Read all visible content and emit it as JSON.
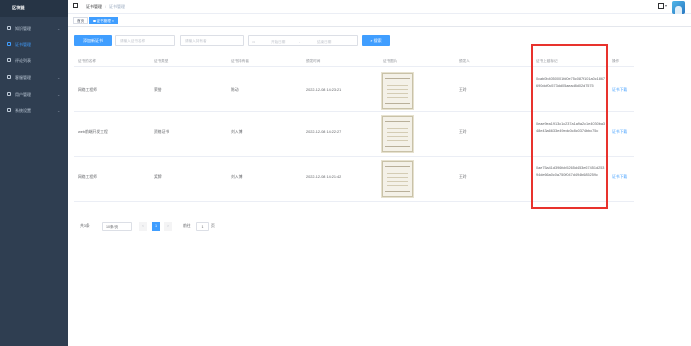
{
  "sidebar": {
    "title": "区块链",
    "items": [
      {
        "label": "知识管理",
        "icon": "doc-icon",
        "chevron": "⌄",
        "active": false
      },
      {
        "label": "证书管理",
        "icon": "certificate-icon",
        "chevron": "",
        "active": true
      },
      {
        "label": "评论列表",
        "icon": "comment-icon",
        "chevron": "",
        "active": false
      },
      {
        "label": "客服管理",
        "icon": "service-icon",
        "chevron": "⌄",
        "active": false
      },
      {
        "label": "用户管理",
        "icon": "user-icon",
        "chevron": "⌄",
        "active": false
      },
      {
        "label": "系统设置",
        "icon": "settings-icon",
        "chevron": "⌄",
        "active": false
      }
    ]
  },
  "header": {
    "breadcrumb": [
      "证书管理",
      "证书管理"
    ],
    "breadcrumb_sep": "/",
    "dropdown": "▾"
  },
  "tags": [
    {
      "label": "首页",
      "active": false
    },
    {
      "label": "证书管理",
      "active": true
    }
  ],
  "toolbar": {
    "add_button": "添加新证书",
    "name_placeholder": "请输入证书名称",
    "owner_placeholder": "请输入持有者",
    "date_start": "开始日期",
    "date_sep": "-",
    "date_end": "结束日期",
    "search_button": "搜索"
  },
  "table": {
    "columns": [
      "证书的名称",
      "证书类型",
      "证书持有者",
      "颁发时间",
      "证书图片",
      "颁发人",
      "证书上链标记",
      "操作"
    ],
    "rows": [
      {
        "name": "网络工程师",
        "type": "荣誉",
        "holder": "陈动",
        "time": "2022-12-08 14:23:21",
        "issuer": "王玲",
        "hash": "0cab0b4050001fd0e75c087f101a0c1867690dcf0c573dd05aead8d02d7575",
        "action": "证书下载"
      },
      {
        "name": "web前端开发工程",
        "type": "资格证书",
        "holder": "刘入博",
        "time": "2022-12-08 14:22:27",
        "issuer": "王玲",
        "hash": "0eae9ea1913c1c237a1a9a2c1e4030ba348e43a6633e49edc0c8c0374bbc75c",
        "action": "证书下载"
      },
      {
        "name": "网络工程师",
        "type": "奖牌",
        "holder": "刘入博",
        "time": "2022-12-08 14:21:42",
        "issuer": "王玲",
        "hash": "0ae75a41d396fcb5265d453e67451d25394de66a0c0a750f047d494b685259c",
        "action": "证书下载"
      }
    ]
  },
  "pagination": {
    "total": "共3条",
    "page_size": "10条/页",
    "prev": "<",
    "current_page": "1",
    "next": ">",
    "goto_label": "前往",
    "goto_value": "1",
    "page_suffix": "页"
  }
}
